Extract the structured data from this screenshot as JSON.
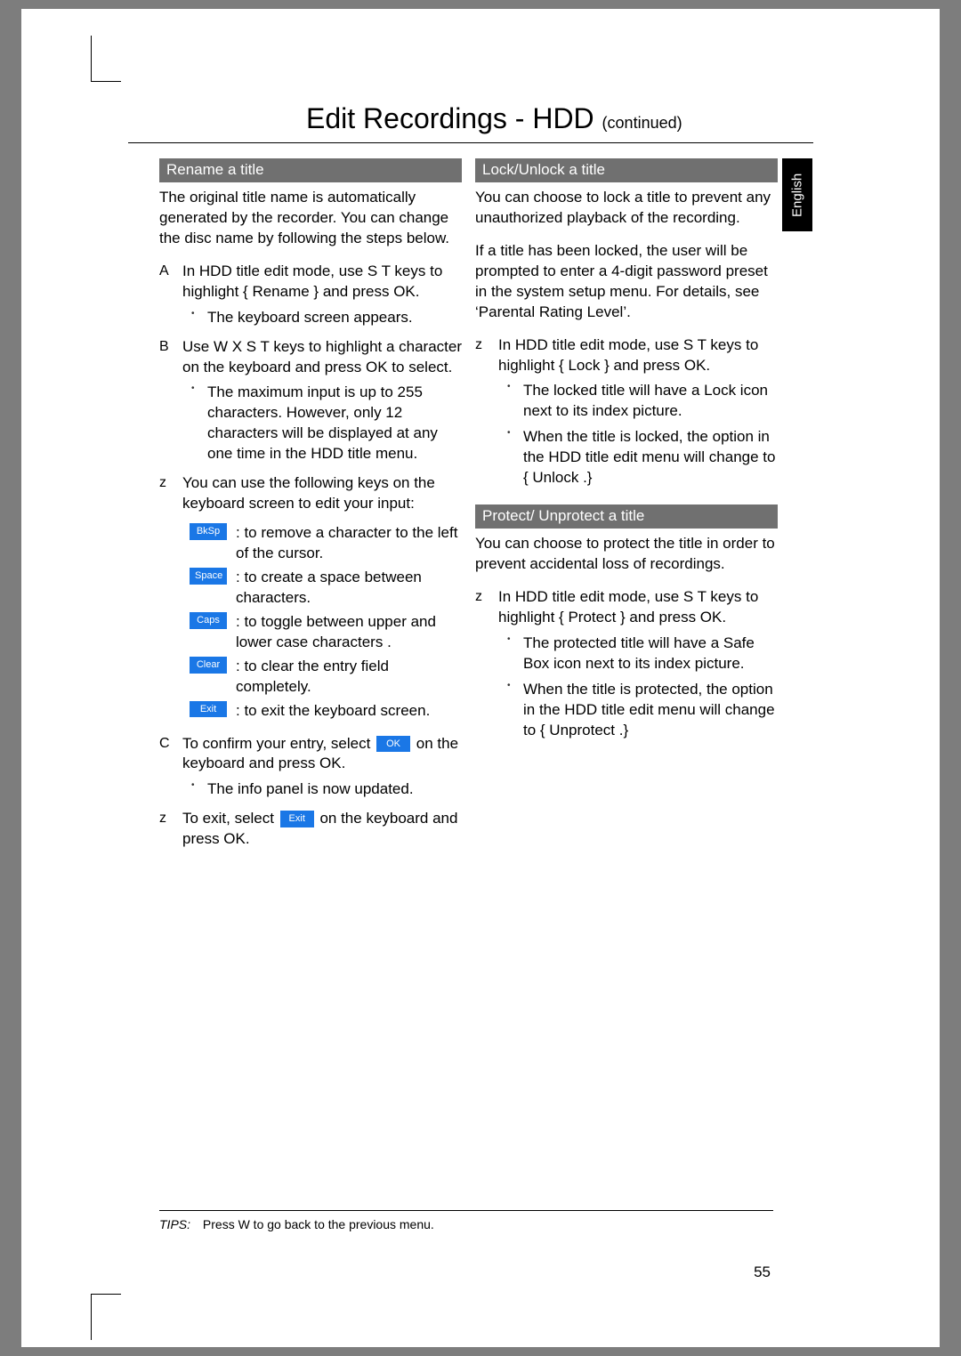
{
  "title_main": "Edit Recordings - HDD",
  "title_cont": "(continued)",
  "lang_tab": "English",
  "page_num": "55",
  "tips_label": "TIPS:",
  "tips_text": "Press W to go back to the previous menu.",
  "left": {
    "section_bar": "Rename a title",
    "intro": "The original title name is automatically generated by the recorder. You can change the disc name by following the steps below.",
    "stepA": {
      "lbl": "A",
      "text": "In HDD title edit mode, use S T keys to highlight { Rename } and press OK."
    },
    "stepA_sub": "The keyboard screen appears.",
    "stepB": {
      "lbl": "B",
      "text": "Use W X S T keys to highlight a character on the keyboard and press OK to select."
    },
    "stepB_sub": "The maximum input is up to 255 characters. However, only 12 characters will be displayed at any one time in the HDD title menu.",
    "keys_intro": {
      "lbl": "z",
      "text": "You can use the following keys on the keyboard screen to edit your input:"
    },
    "keys": [
      {
        "chip": "BkSp",
        "desc": ": to remove a character to the left of the cursor."
      },
      {
        "chip": "Space",
        "desc": ": to create a space between characters."
      },
      {
        "chip": "Caps",
        "desc": ": to toggle between upper and lower case characters ."
      },
      {
        "chip": "Clear",
        "desc": ": to clear the entry ﬁeld completely."
      },
      {
        "chip": "Exit",
        "desc": ": to exit the keyboard screen."
      }
    ],
    "stepC": {
      "lbl": "C",
      "pre": "To conﬁrm your entry, select ",
      "chip": "OK",
      "post": " on the keyboard and press OK."
    },
    "stepC_sub": "The info panel is now updated.",
    "stepZ": {
      "lbl": "z",
      "pre": "To exit, select ",
      "chip": "Exit",
      "post": " on the keyboard and press OK."
    }
  },
  "right": {
    "lock_bar": "Lock/Unlock a title",
    "lock_p1": "You can choose to lock a title to prevent any unauthorized playback of the recording.",
    "lock_p2": "If a title has been locked, the user will be prompted to enter a 4-digit password preset in the system setup menu. For details, see ‘Parental Rating Level’.",
    "lock_step": {
      "lbl": "z",
      "text": "In HDD title edit mode, use S T keys to highlight { Lock } and press OK."
    },
    "lock_sub1": "The locked title will have a Lock icon next to its index picture.",
    "lock_sub2": "When the title is locked, the option in the HDD title edit menu will change to { Unlock  .}",
    "prot_bar": "Protect/ Unprotect a title",
    "prot_p1": "You can choose to protect the title in order to prevent accidental loss of recordings.",
    "prot_step": {
      "lbl": "z",
      "text": "In HDD title edit mode, use S T keys to highlight { Protect  } and press OK."
    },
    "prot_sub1": "The protected title will have a Safe Box icon       next to its index picture.",
    "prot_sub2": "When the title is protected, the option in the HDD title edit menu will change to { Unprotect  .}"
  }
}
